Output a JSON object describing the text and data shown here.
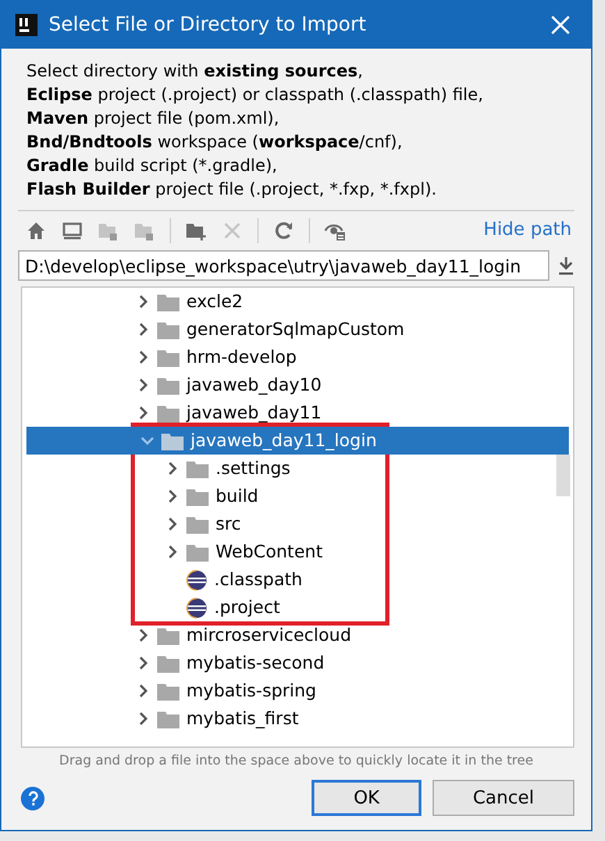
{
  "window": {
    "title": "Select File or Directory to Import"
  },
  "description": [
    "Select directory with **existing sources**,",
    "**Eclipse** project (.project) or classpath (.classpath) file,",
    "**Maven** project file (pom.xml),",
    "**Bnd/Bndtools** workspace (**workspace**/cnf),",
    "**Gradle** build script (*.gradle),",
    "**Flash Builder** project file (.project, *.fxp, *.fxpl)."
  ],
  "toolbar": [
    {
      "kind": "home",
      "disabled": false
    },
    {
      "kind": "desktop",
      "disabled": false
    },
    {
      "kind": "folder",
      "disabled": true
    },
    {
      "kind": "folder",
      "disabled": true
    },
    {
      "kind": "new-folder",
      "disabled": false
    },
    {
      "kind": "delete",
      "disabled": true
    },
    {
      "kind": "refresh",
      "disabled": false
    },
    {
      "kind": "hidden",
      "disabled": false
    }
  ],
  "hide_path_link": "Hide path",
  "path_field": {
    "value": "D:\\develop\\eclipse_workspace\\utry\\javaweb_day11_login"
  },
  "tree": [
    {
      "label": "excle2",
      "kind": "folder",
      "expanded": false,
      "selected": false
    },
    {
      "label": "generatorSqlmapCustom",
      "kind": "folder",
      "expanded": false,
      "selected": false
    },
    {
      "label": "hrm-develop",
      "kind": "folder",
      "expanded": false,
      "selected": false
    },
    {
      "label": "javaweb_day10",
      "kind": "folder",
      "expanded": false,
      "selected": false
    },
    {
      "label": "javaweb_day11",
      "kind": "folder",
      "expanded": false,
      "selected": false
    },
    {
      "label": "javaweb_day11_login",
      "kind": "folder",
      "expanded": true,
      "selected": true,
      "highlighted": true,
      "children": [
        {
          "label": ".settings",
          "kind": "folder",
          "expanded": false,
          "selected": false
        },
        {
          "label": "build",
          "kind": "folder",
          "expanded": false,
          "selected": false
        },
        {
          "label": "src",
          "kind": "folder",
          "expanded": false,
          "selected": false
        },
        {
          "label": "WebContent",
          "kind": "folder",
          "expanded": false,
          "selected": false
        },
        {
          "label": ".classpath",
          "kind": "file",
          "selected": false
        },
        {
          "label": ".project",
          "kind": "file",
          "selected": false
        }
      ]
    },
    {
      "label": "mircroservicecloud",
      "kind": "folder",
      "expanded": false,
      "selected": false
    },
    {
      "label": "mybatis-second",
      "kind": "folder",
      "expanded": false,
      "selected": false
    },
    {
      "label": "mybatis-spring",
      "kind": "folder",
      "expanded": false,
      "selected": false
    },
    {
      "label": "mybatis_first",
      "kind": "folder",
      "expanded": false,
      "selected": false
    }
  ],
  "hint": "Drag and drop a file into the space above to quickly locate it in the tree",
  "buttons": [
    {
      "label": "OK",
      "kind": "default"
    },
    {
      "label": "Cancel",
      "kind": "normal"
    }
  ]
}
